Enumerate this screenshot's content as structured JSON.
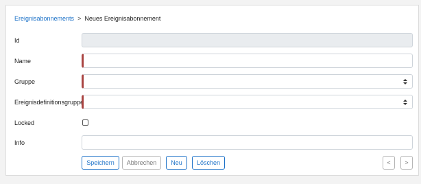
{
  "breadcrumb": {
    "parent": "Ereignisabonnements",
    "separator": ">",
    "current": "Neues Ereignisabonnement"
  },
  "form": {
    "fields": {
      "id": {
        "label": "Id",
        "value": ""
      },
      "name": {
        "label": "Name",
        "value": "",
        "required": true
      },
      "gruppe": {
        "label": "Gruppe",
        "value": "",
        "required": true
      },
      "ereignisdefinitionsgruppe": {
        "label": "Ereignisdefinitionsgruppe",
        "value": "",
        "required": true
      },
      "locked": {
        "label": "Locked",
        "checked": false
      },
      "info": {
        "label": "Info",
        "value": ""
      }
    }
  },
  "actions": {
    "save_label": "Speichern",
    "cancel_label": "Abbrechen",
    "new_label": "Neu",
    "delete_label": "Löschen",
    "prev_label": "<",
    "next_label": ">"
  },
  "colors": {
    "link": "#1d72c8",
    "required_marker": "#a94442",
    "disabled_field": "#e9ecef"
  }
}
